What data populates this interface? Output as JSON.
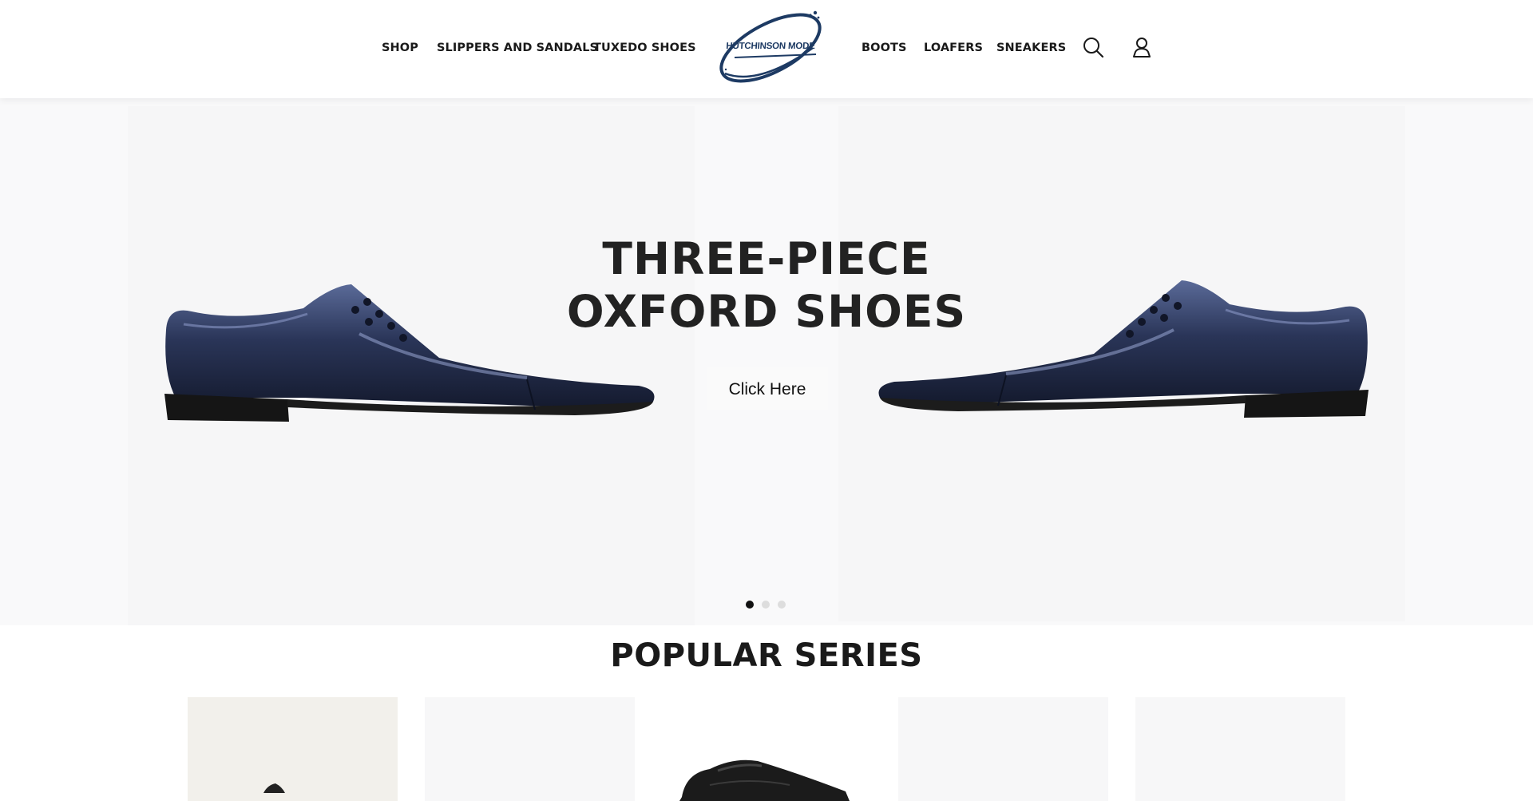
{
  "header": {
    "nav_left": [
      {
        "label": "SHOP"
      },
      {
        "label": "SLIPPERS AND SANDALS"
      },
      {
        "label": "TUXEDO SHOES"
      }
    ],
    "nav_right": [
      {
        "label": "BOOTS"
      },
      {
        "label": "LOAFERS"
      },
      {
        "label": "SNEAKERS"
      }
    ],
    "logo_text": "HUTCHINSON MODE",
    "icons": [
      "search-icon",
      "user-icon"
    ]
  },
  "hero": {
    "title_line1": "THREE-PIECE",
    "title_line2": "OXFORD SHOES",
    "cta_label": "Click Here",
    "slides_total": 3,
    "active_slide": 1
  },
  "popular": {
    "title": "POPULAR SERIES",
    "cards": 5
  },
  "colors": {
    "logo_navy": "#1d3a63",
    "shoe_navy": "#2b3756",
    "text_dark": "#222222",
    "hero_bg": "#f9f9fa"
  }
}
